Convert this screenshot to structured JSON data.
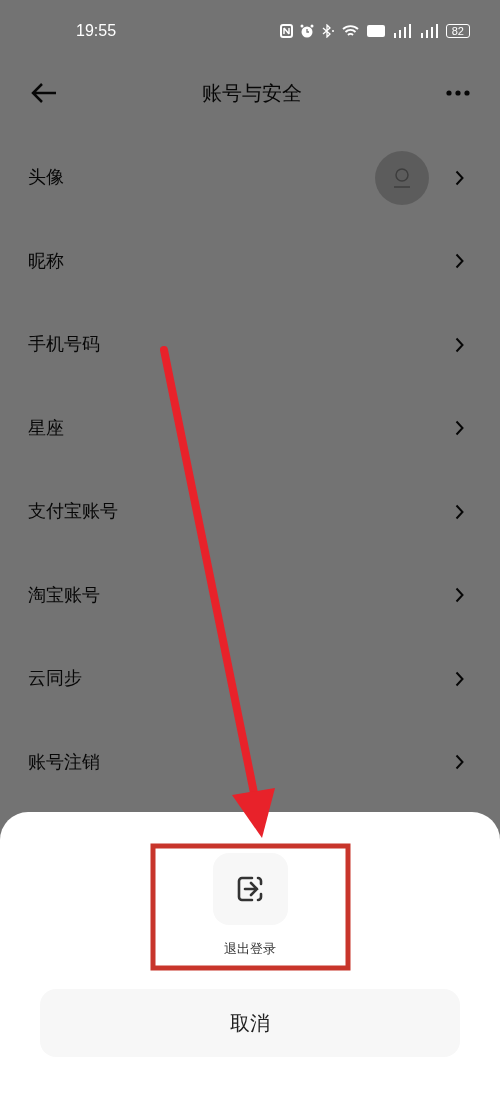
{
  "status_bar": {
    "time": "19:55",
    "battery": "82"
  },
  "header": {
    "title": "账号与安全"
  },
  "settings_items": [
    {
      "label": "头像",
      "kind": "avatar"
    },
    {
      "label": "昵称",
      "kind": "plain"
    },
    {
      "label": "手机号码",
      "kind": "plain"
    },
    {
      "label": "星座",
      "kind": "plain"
    },
    {
      "label": "支付宝账号",
      "kind": "plain"
    },
    {
      "label": "淘宝账号",
      "kind": "plain"
    },
    {
      "label": "云同步",
      "kind": "plain"
    },
    {
      "label": "账号注销",
      "kind": "plain"
    }
  ],
  "bottom_sheet": {
    "actions": [
      {
        "label": "退出登录"
      }
    ],
    "cancel": "取消"
  }
}
